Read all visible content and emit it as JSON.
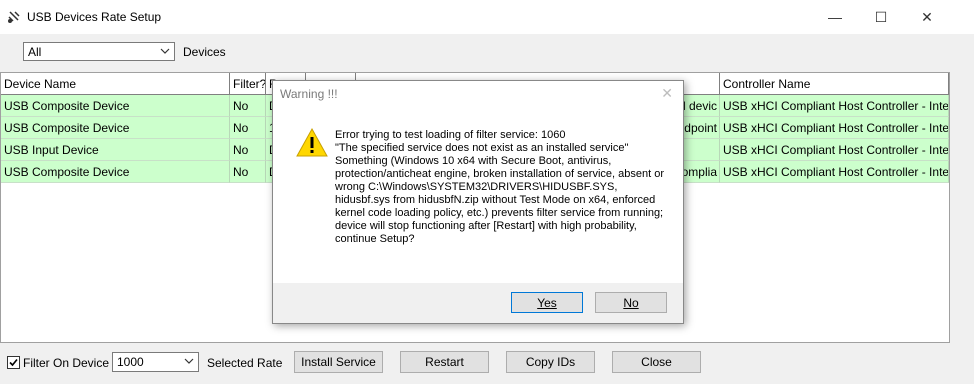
{
  "window": {
    "title": "USB Devices Rate Setup",
    "minimize_glyph": "—",
    "maximize_glyph": "☐",
    "close_glyph": "✕"
  },
  "toolbar": {
    "filter_value": "All",
    "devices_label": "Devices"
  },
  "table": {
    "columns": [
      "Device Name",
      "Filter?",
      "R",
      "",
      "",
      "Controller Name"
    ],
    "rows": [
      [
        "USB Composite Device",
        "No",
        "D",
        "",
        "ed devic",
        "USB xHCI Compliant Host Controller - Intel(R) U"
      ],
      [
        "USB Composite Device",
        "No",
        "1",
        "",
        "ndpoint",
        "USB xHCI Compliant Host Controller - Intel(R) U"
      ],
      [
        "USB Input Device",
        "No",
        "D",
        "",
        "",
        "USB xHCI Compliant Host Controller - Intel(R) U"
      ],
      [
        "USB Composite Device",
        "No",
        "D",
        "",
        "-complia",
        "USB xHCI Compliant Host Controller - Intel(R) U"
      ]
    ]
  },
  "bottom": {
    "filter_on_device_label": "Filter On Device",
    "filter_on_device_checked": true,
    "rate_value": "1000",
    "selected_rate_label": "Selected Rate",
    "install_service_label": "Install Service",
    "restart_label": "Restart",
    "copy_ids_label": "Copy IDs",
    "close_label": "Close"
  },
  "dialog": {
    "title": "Warning !!!",
    "icon": "warning-icon",
    "message": "Error trying to test loading of filter service: 1060\n\"The specified service does not exist as an installed service\"\nSomething (Windows 10 x64 with Secure Boot, antivirus, protection/anticheat engine, broken installation of service, absent or wrong C:\\Windows\\SYSTEM32\\DRIVERS\\HIDUSBF.SYS, hidusbf.sys from hidusbfN.zip without Test Mode on x64, enforced kernel code loading policy, etc.) prevents filter service from running; device will stop functioning after [Restart] with high probability, continue Setup?",
    "yes_label": "Yes",
    "no_label": "No",
    "close_glyph": "✕"
  },
  "colors": {
    "row_green": "#ccffcc",
    "warning_yellow": "#ffd700",
    "focus_blue": "#0078d7"
  }
}
